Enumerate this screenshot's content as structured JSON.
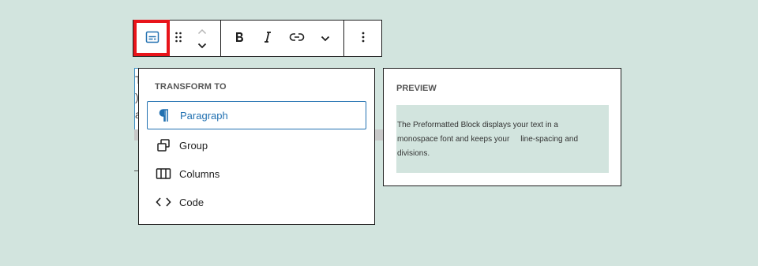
{
  "transform_menu": {
    "heading": "TRANSFORM TO",
    "items": [
      {
        "label": "Paragraph",
        "icon": "paragraph-icon",
        "active": true
      },
      {
        "label": "Group",
        "icon": "group-icon",
        "active": false
      },
      {
        "label": "Columns",
        "icon": "columns-icon",
        "active": false
      },
      {
        "label": "Code",
        "icon": "code-icon",
        "active": false
      }
    ]
  },
  "preview": {
    "heading": "PREVIEW",
    "text": "The Preformatted Block displays your text in a\nmonospace font and keeps your     line-spacing and\ndivisions."
  },
  "behind_text": {
    "line1": "T",
    "line2": ")",
    "line3": "a"
  },
  "colors": {
    "background": "#d2e4de",
    "accent": "#2271b1",
    "highlight": "#e8141a"
  }
}
